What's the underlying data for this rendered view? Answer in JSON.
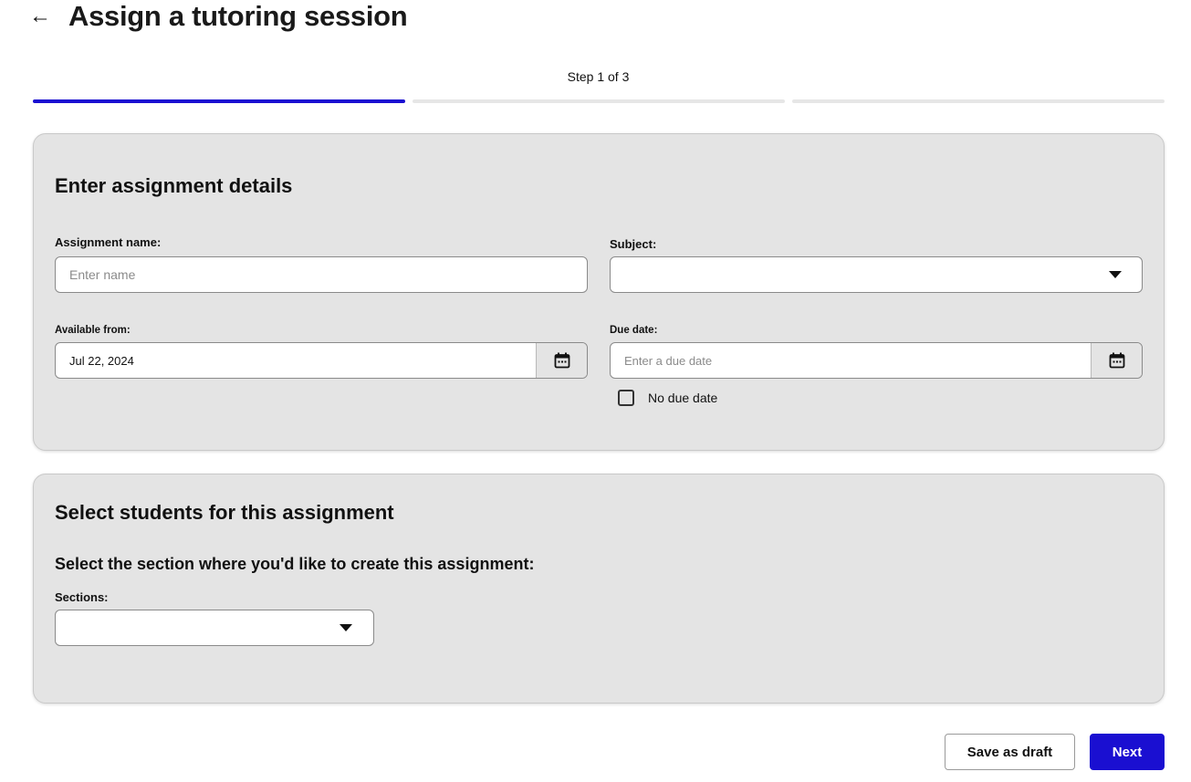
{
  "header": {
    "back_icon": "arrow-left-icon",
    "title": "Assign a tutoring session"
  },
  "stepper": {
    "label": "Step 1 of 3",
    "total_steps": 3,
    "current_step": 1,
    "active_color": "#1a0fd1"
  },
  "details": {
    "title": "Enter assignment details",
    "name": {
      "label": "Assignment name:",
      "placeholder": "Enter name",
      "value": ""
    },
    "subject": {
      "label": "Subject:",
      "value": ""
    },
    "available_from": {
      "label": "Available from:",
      "value": "Jul 22, 2024",
      "icon": "calendar-icon"
    },
    "due_date": {
      "label": "Due date:",
      "placeholder": "Enter a due date",
      "value": "",
      "icon": "calendar-icon"
    },
    "no_due_date": {
      "label": "No due date",
      "checked": false
    }
  },
  "students": {
    "title": "Select students for this assignment",
    "subheading": "Select the section where you'd like to create this assignment:",
    "sections": {
      "label": "Sections:",
      "value": ""
    }
  },
  "footer": {
    "save_draft_label": "Save as draft",
    "next_label": "Next"
  }
}
